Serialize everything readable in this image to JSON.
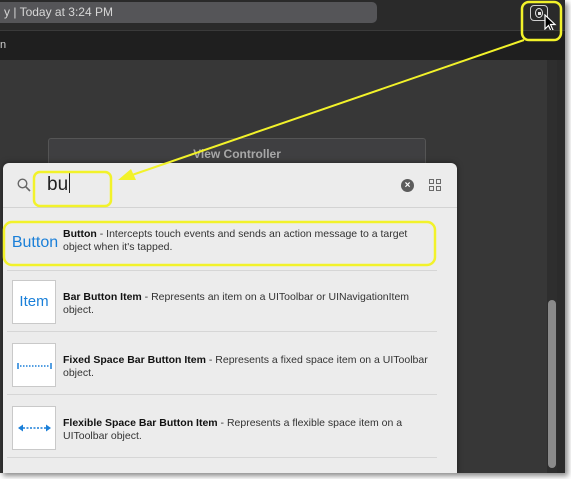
{
  "titlebar": {
    "activity_text": "y | Today at 3:24 PM"
  },
  "tabbar": {
    "tab_fragment": "n"
  },
  "canvas": {
    "scene_header": "View Controller"
  },
  "library": {
    "search": {
      "value": "bu"
    },
    "items": [
      {
        "thumb": "Button",
        "name": "Button",
        "desc": " - Intercepts touch events and sends an action message to a target object when it's tapped."
      },
      {
        "thumb": "Item",
        "name": "Bar Button Item",
        "desc": " - Represents an item on a UIToolbar or UINavigationItem object."
      },
      {
        "thumb": "",
        "name": "Fixed Space Bar Button Item",
        "desc": " - Represents a fixed space item on a UIToolbar object."
      },
      {
        "thumb": "",
        "name": "Flexible Space Bar Button Item",
        "desc": " - Represents a flexible space item on a UIToolbar object."
      }
    ]
  },
  "colors": {
    "annotation": "#f2f22a",
    "accent_blue": "#1a7fd8"
  }
}
